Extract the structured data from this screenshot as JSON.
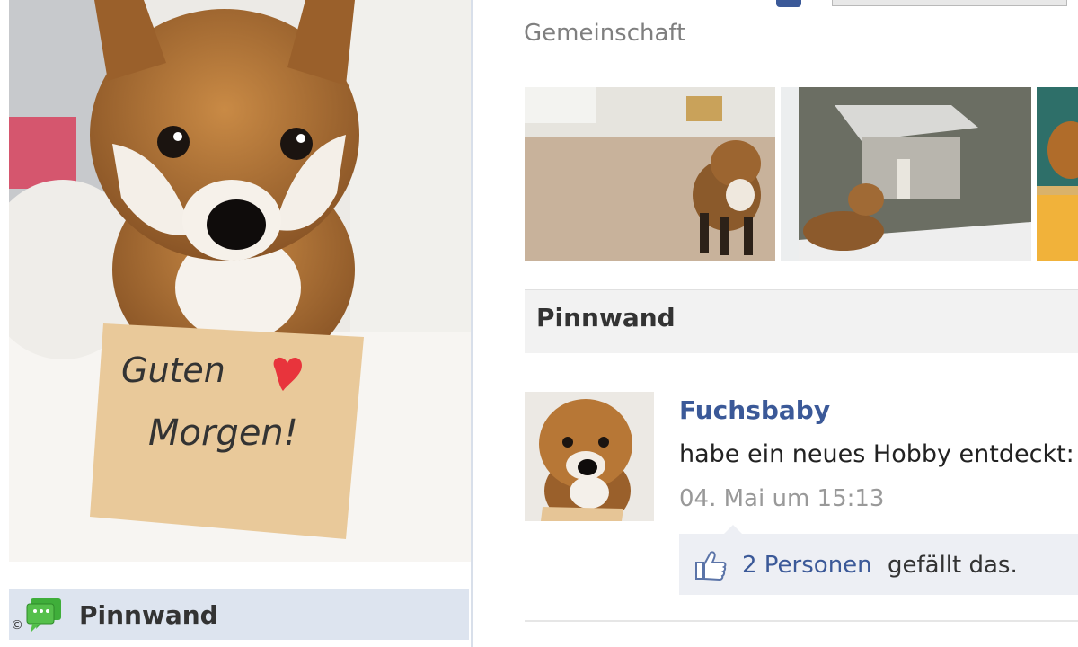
{
  "left": {
    "photo": {
      "note_line1": "Guten",
      "note_line2": "Morgen!"
    },
    "nav_item": {
      "label": "Pinnwand",
      "icon": "speech-bubble-icon"
    },
    "copyright": "©"
  },
  "header": {
    "category": "Gemeinschaft"
  },
  "section": {
    "title": "Pinnwand"
  },
  "post": {
    "author": "Fuchsbaby",
    "text": "habe ein neues Hobby entdeckt:",
    "timestamp": "04. Mai um 15:13",
    "likes_count": "2 Personen",
    "likes_suffix": "gefällt das.",
    "like_icon": "thumbs-up-icon"
  },
  "colors": {
    "link": "#3b5998",
    "nav_bg": "#dde4ef",
    "like_bg": "#edeff4"
  }
}
